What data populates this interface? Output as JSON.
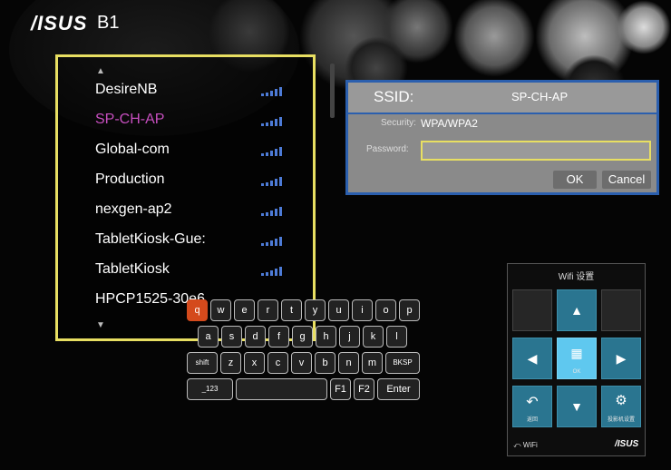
{
  "header": {
    "brand": "/ISUS",
    "model": "B1"
  },
  "wifi_list": {
    "scroll_up_icon": "triangle-up",
    "scroll_down_icon": "triangle-down",
    "networks": [
      {
        "name": "DesireNB",
        "selected": false,
        "signal_bars": 5
      },
      {
        "name": "SP-CH-AP",
        "selected": true,
        "signal_bars": 5
      },
      {
        "name": "Global-com",
        "selected": false,
        "signal_bars": 5
      },
      {
        "name": "Production",
        "selected": false,
        "signal_bars": 5
      },
      {
        "name": "nexgen-ap2",
        "selected": false,
        "signal_bars": 5
      },
      {
        "name": "TabletKiosk-Gue:",
        "selected": false,
        "signal_bars": 5
      },
      {
        "name": "TabletKiosk",
        "selected": false,
        "signal_bars": 5
      },
      {
        "name": "HPCP1525-30e6",
        "selected": false,
        "signal_bars": 5
      }
    ]
  },
  "ssid_panel": {
    "ssid_label": "SSID:",
    "ssid_value": "SP-CH-AP",
    "security_label": "Security:",
    "security_value": "WPA/WPA2",
    "password_label": "Password:",
    "password_value": "",
    "ok_label": "OK",
    "cancel_label": "Cancel"
  },
  "keyboard": {
    "row1": [
      "q",
      "w",
      "e",
      "r",
      "t",
      "y",
      "u",
      "i",
      "o",
      "p"
    ],
    "row2": [
      "a",
      "s",
      "d",
      "f",
      "g",
      "h",
      "j",
      "k",
      "l"
    ],
    "row3": [
      "shift",
      "z",
      "x",
      "c",
      "v",
      "b",
      "n",
      "m",
      "BKSP"
    ],
    "row4": [
      "_123",
      "",
      "F1",
      "F2",
      "Enter"
    ],
    "selected_key": "q"
  },
  "remote": {
    "title": "Wifi 设置",
    "ok_caption": "OK",
    "back_caption": "返回",
    "settings_caption": "投影机设置",
    "footer_label": "WiFi",
    "footer_logo": "/ISUS"
  },
  "colors": {
    "list_border": "#e8df62",
    "selected_network": "#c84fc0",
    "panel_border": "#2b5fae",
    "selected_key": "#d44a1c",
    "remote_blue": "#2a7590",
    "remote_ok": "#5fc8ef",
    "signal": "#4d7bd7"
  }
}
